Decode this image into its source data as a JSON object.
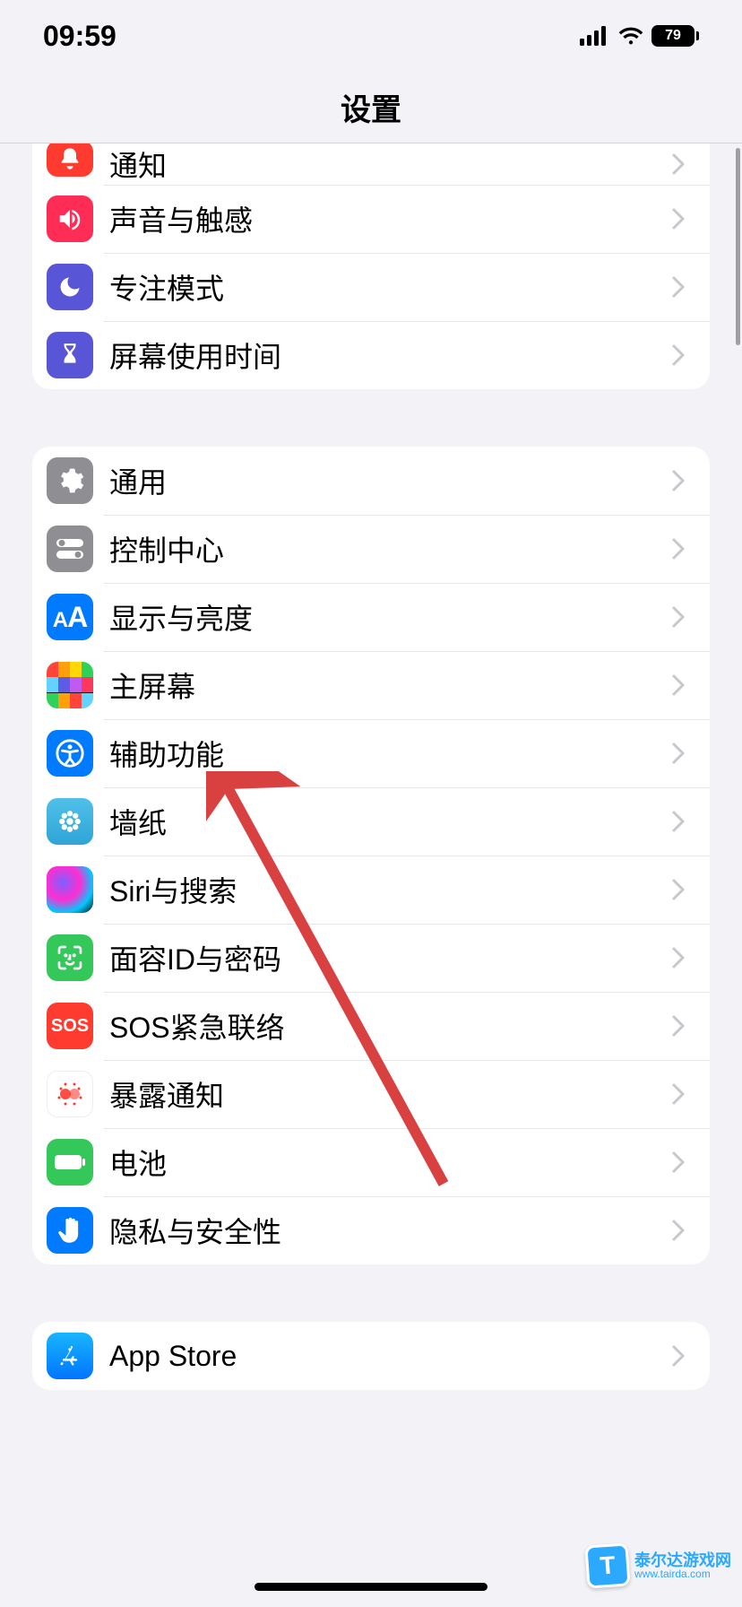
{
  "status": {
    "time": "09:59",
    "battery": "79"
  },
  "header": {
    "title": "设置"
  },
  "group1": {
    "items": [
      {
        "label": "通知",
        "icon": "bell-icon",
        "bg": "bg-red"
      },
      {
        "label": "声音与触感",
        "icon": "volume-icon",
        "bg": "bg-pink"
      },
      {
        "label": "专注模式",
        "icon": "moon-icon",
        "bg": "bg-indigo"
      },
      {
        "label": "屏幕使用时间",
        "icon": "hourglass-icon",
        "bg": "bg-indigo"
      }
    ]
  },
  "group2": {
    "items": [
      {
        "label": "通用",
        "icon": "gear-icon",
        "bg": "bg-gray"
      },
      {
        "label": "控制中心",
        "icon": "switches-icon",
        "bg": "bg-gray"
      },
      {
        "label": "显示与亮度",
        "icon": "text-size-icon",
        "bg": "bg-blue"
      },
      {
        "label": "主屏幕",
        "icon": "home-grid-icon",
        "bg": "home-grid"
      },
      {
        "label": "辅助功能",
        "icon": "accessibility-icon",
        "bg": "bg-blue"
      },
      {
        "label": "墙纸",
        "icon": "flower-icon",
        "bg": "bg-cyan-grad"
      },
      {
        "label": "Siri与搜索",
        "icon": "siri-icon",
        "bg": "bg-siri"
      },
      {
        "label": "面容ID与密码",
        "icon": "faceid-icon",
        "bg": "bg-green"
      },
      {
        "label": "SOS紧急联络",
        "icon": "sos-icon",
        "bg": "bg-red2"
      },
      {
        "label": "暴露通知",
        "icon": "exposure-icon",
        "bg": "bg-white-red"
      },
      {
        "label": "电池",
        "icon": "battery-icon",
        "bg": "bg-green"
      },
      {
        "label": "隐私与安全性",
        "icon": "hand-icon",
        "bg": "bg-blue"
      }
    ]
  },
  "group3": {
    "items": [
      {
        "label": "App Store",
        "icon": "appstore-icon",
        "bg": "bg-appstore"
      }
    ]
  },
  "watermark": {
    "cn": "泰尔达游戏网",
    "url": "www.tairda.com"
  },
  "annotation": {
    "arrow_color": "#d94141"
  }
}
